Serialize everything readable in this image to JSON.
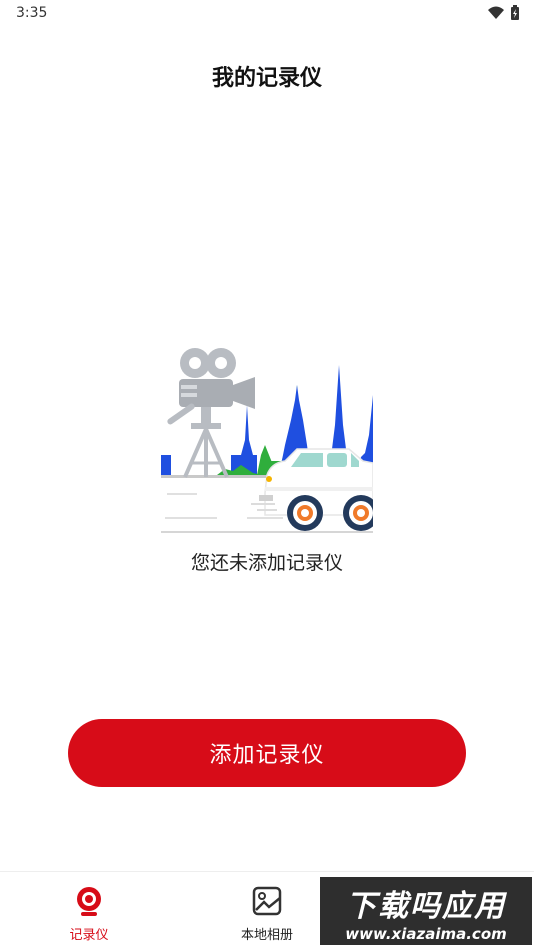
{
  "status_bar": {
    "time": "3:35",
    "wifi_icon": "wifi-icon",
    "battery_icon": "battery-charging-icon"
  },
  "header": {
    "title": "我的记录仪"
  },
  "empty_state": {
    "illustration": "camera-car-city-illustration",
    "message": "您还未添加记录仪"
  },
  "actions": {
    "add_label": "添加记录仪"
  },
  "bottom_nav": {
    "items": [
      {
        "label": "记录仪",
        "icon": "dashcam-icon",
        "active": true
      },
      {
        "label": "本地相册",
        "icon": "album-icon",
        "active": false
      }
    ]
  },
  "watermark": {
    "title": "下载吗应用",
    "url": "www.xiazaima.com"
  },
  "colors": {
    "accent": "#d70c18",
    "city_blue": "#1f4fe0",
    "city_green": "#2fae3c"
  }
}
